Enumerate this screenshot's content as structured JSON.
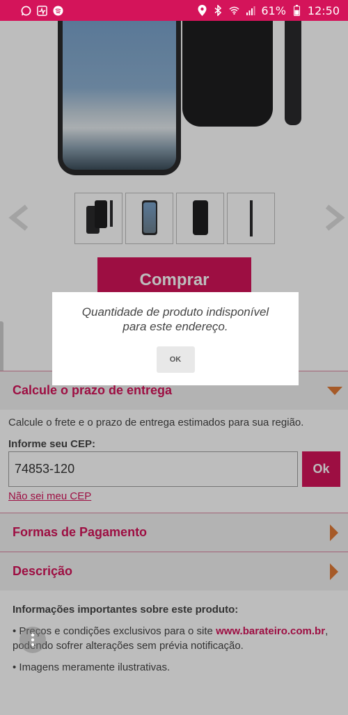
{
  "status_bar": {
    "battery": "61%",
    "time": "12:50"
  },
  "product": {
    "buy_label": "Comprar"
  },
  "dialog": {
    "message": "Quantidade de produto indisponível para este endereço.",
    "ok_label": "OK"
  },
  "shipping": {
    "header": "Calcule o prazo de entrega",
    "description": "Calcule o frete e o prazo de entrega estimados para sua região.",
    "cep_label": "Informe seu CEP:",
    "cep_value": "74853-120",
    "ok_label": "Ok",
    "unknown_cep_link": "Não sei meu CEP"
  },
  "payment": {
    "header": "Formas de Pagamento"
  },
  "description": {
    "header": "Descrição"
  },
  "info": {
    "title": "Informações importantes sobre este produto:",
    "item1_prefix": "• Preços e condições exclusivos para o site",
    "item1_link": "www.barateiro.com.br",
    "item1_suffix": ", podendo sofrer alterações sem prévia notificação.",
    "item2": "• Imagens meramente ilustrativas."
  },
  "colors": {
    "brand": "#d4145a",
    "accent_arrow": "#e07a36"
  },
  "icons": [
    "whatsapp-icon",
    "activity-icon",
    "spotify-icon",
    "location-icon",
    "bluetooth-icon",
    "wifi-icon",
    "signal-icon",
    "battery-icon",
    "chevron-left-icon",
    "chevron-right-icon",
    "more-vert-icon"
  ]
}
